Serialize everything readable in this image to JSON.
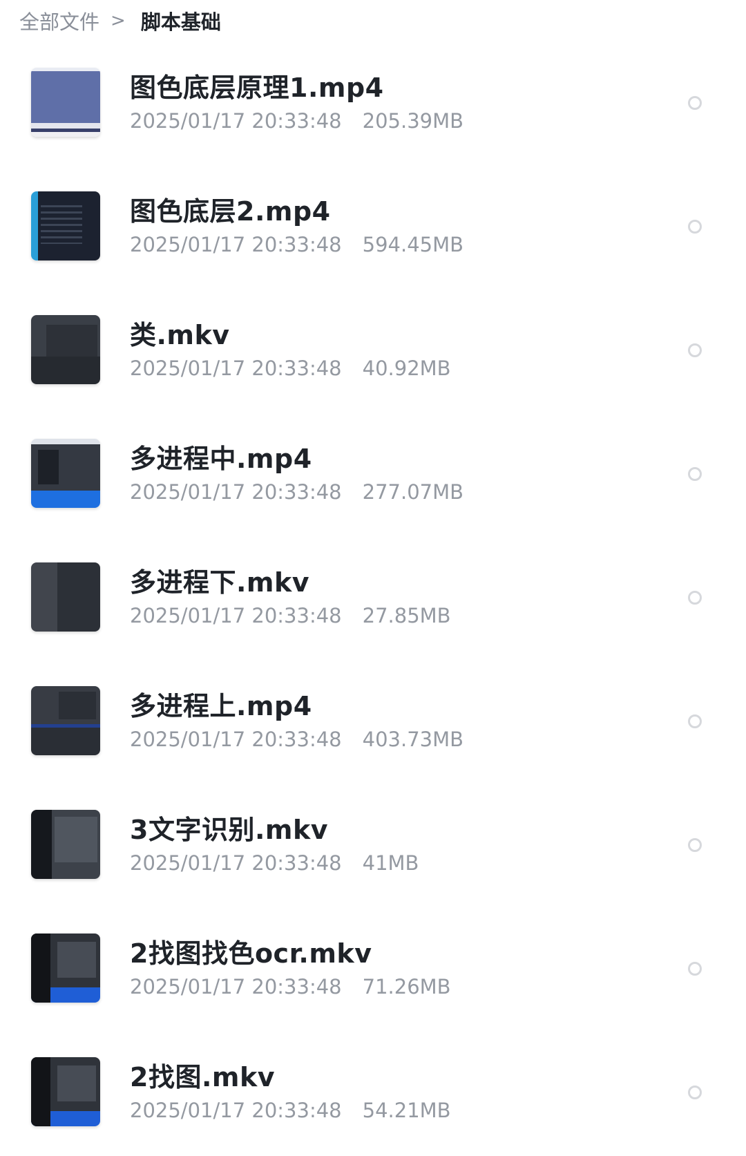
{
  "breadcrumb": {
    "root": "全部文件",
    "separator": ">",
    "current": "脚本基础"
  },
  "files": [
    {
      "name": "图色底层原理1.mp4",
      "date": "2025/01/17 20:33:48",
      "size": "205.39MB",
      "thumb_icon": "video-thumbnail"
    },
    {
      "name": "图色底层2.mp4",
      "date": "2025/01/17 20:33:48",
      "size": "594.45MB",
      "thumb_icon": "video-thumbnail"
    },
    {
      "name": "类.mkv",
      "date": "2025/01/17 20:33:48",
      "size": "40.92MB",
      "thumb_icon": "video-thumbnail"
    },
    {
      "name": "多进程中.mp4",
      "date": "2025/01/17 20:33:48",
      "size": "277.07MB",
      "thumb_icon": "video-thumbnail"
    },
    {
      "name": "多进程下.mkv",
      "date": "2025/01/17 20:33:48",
      "size": "27.85MB",
      "thumb_icon": "video-thumbnail"
    },
    {
      "name": "多进程上.mp4",
      "date": "2025/01/17 20:33:48",
      "size": "403.73MB",
      "thumb_icon": "video-thumbnail"
    },
    {
      "name": "3文字识别.mkv",
      "date": "2025/01/17 20:33:48",
      "size": "41MB",
      "thumb_icon": "video-thumbnail"
    },
    {
      "name": "2找图找色ocr.mkv",
      "date": "2025/01/17 20:33:48",
      "size": "71.26MB",
      "thumb_icon": "video-thumbnail"
    },
    {
      "name": "2找图.mkv",
      "date": "2025/01/17 20:33:48",
      "size": "54.21MB",
      "thumb_icon": "video-thumbnail"
    }
  ],
  "colors": {
    "title_text": "#1f2329",
    "meta_text": "#9499a1",
    "select_circle": "#d6d8dc"
  }
}
